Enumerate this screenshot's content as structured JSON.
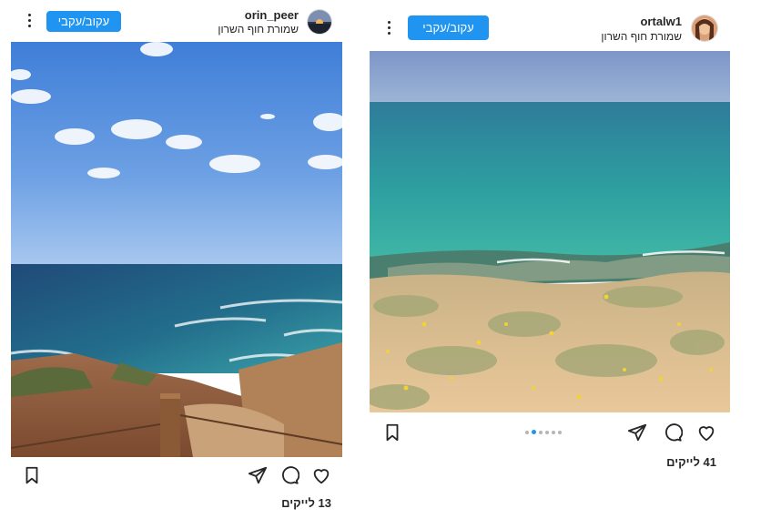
{
  "posts": [
    {
      "username": "orin_peer",
      "location": "שמורת חוף השרון",
      "follow_label": "עקוב/עקבי",
      "likes": "13 לייקים",
      "photo_alt": "cliff coast with blue sky"
    },
    {
      "username": "ortalw1",
      "location": "שמורת חוף השרון",
      "follow_label": "עקוב/עקבי",
      "likes": "41 לייקים",
      "photo_alt": "turquoise sea over sandy dunes",
      "carousel": {
        "count": 6,
        "active_index": 1
      }
    }
  ],
  "colors": {
    "accent": "#1f95f1",
    "text": "#262626"
  },
  "icons": [
    "heart-icon",
    "comment-icon",
    "share-icon",
    "bookmark-icon",
    "more-options-icon"
  ]
}
